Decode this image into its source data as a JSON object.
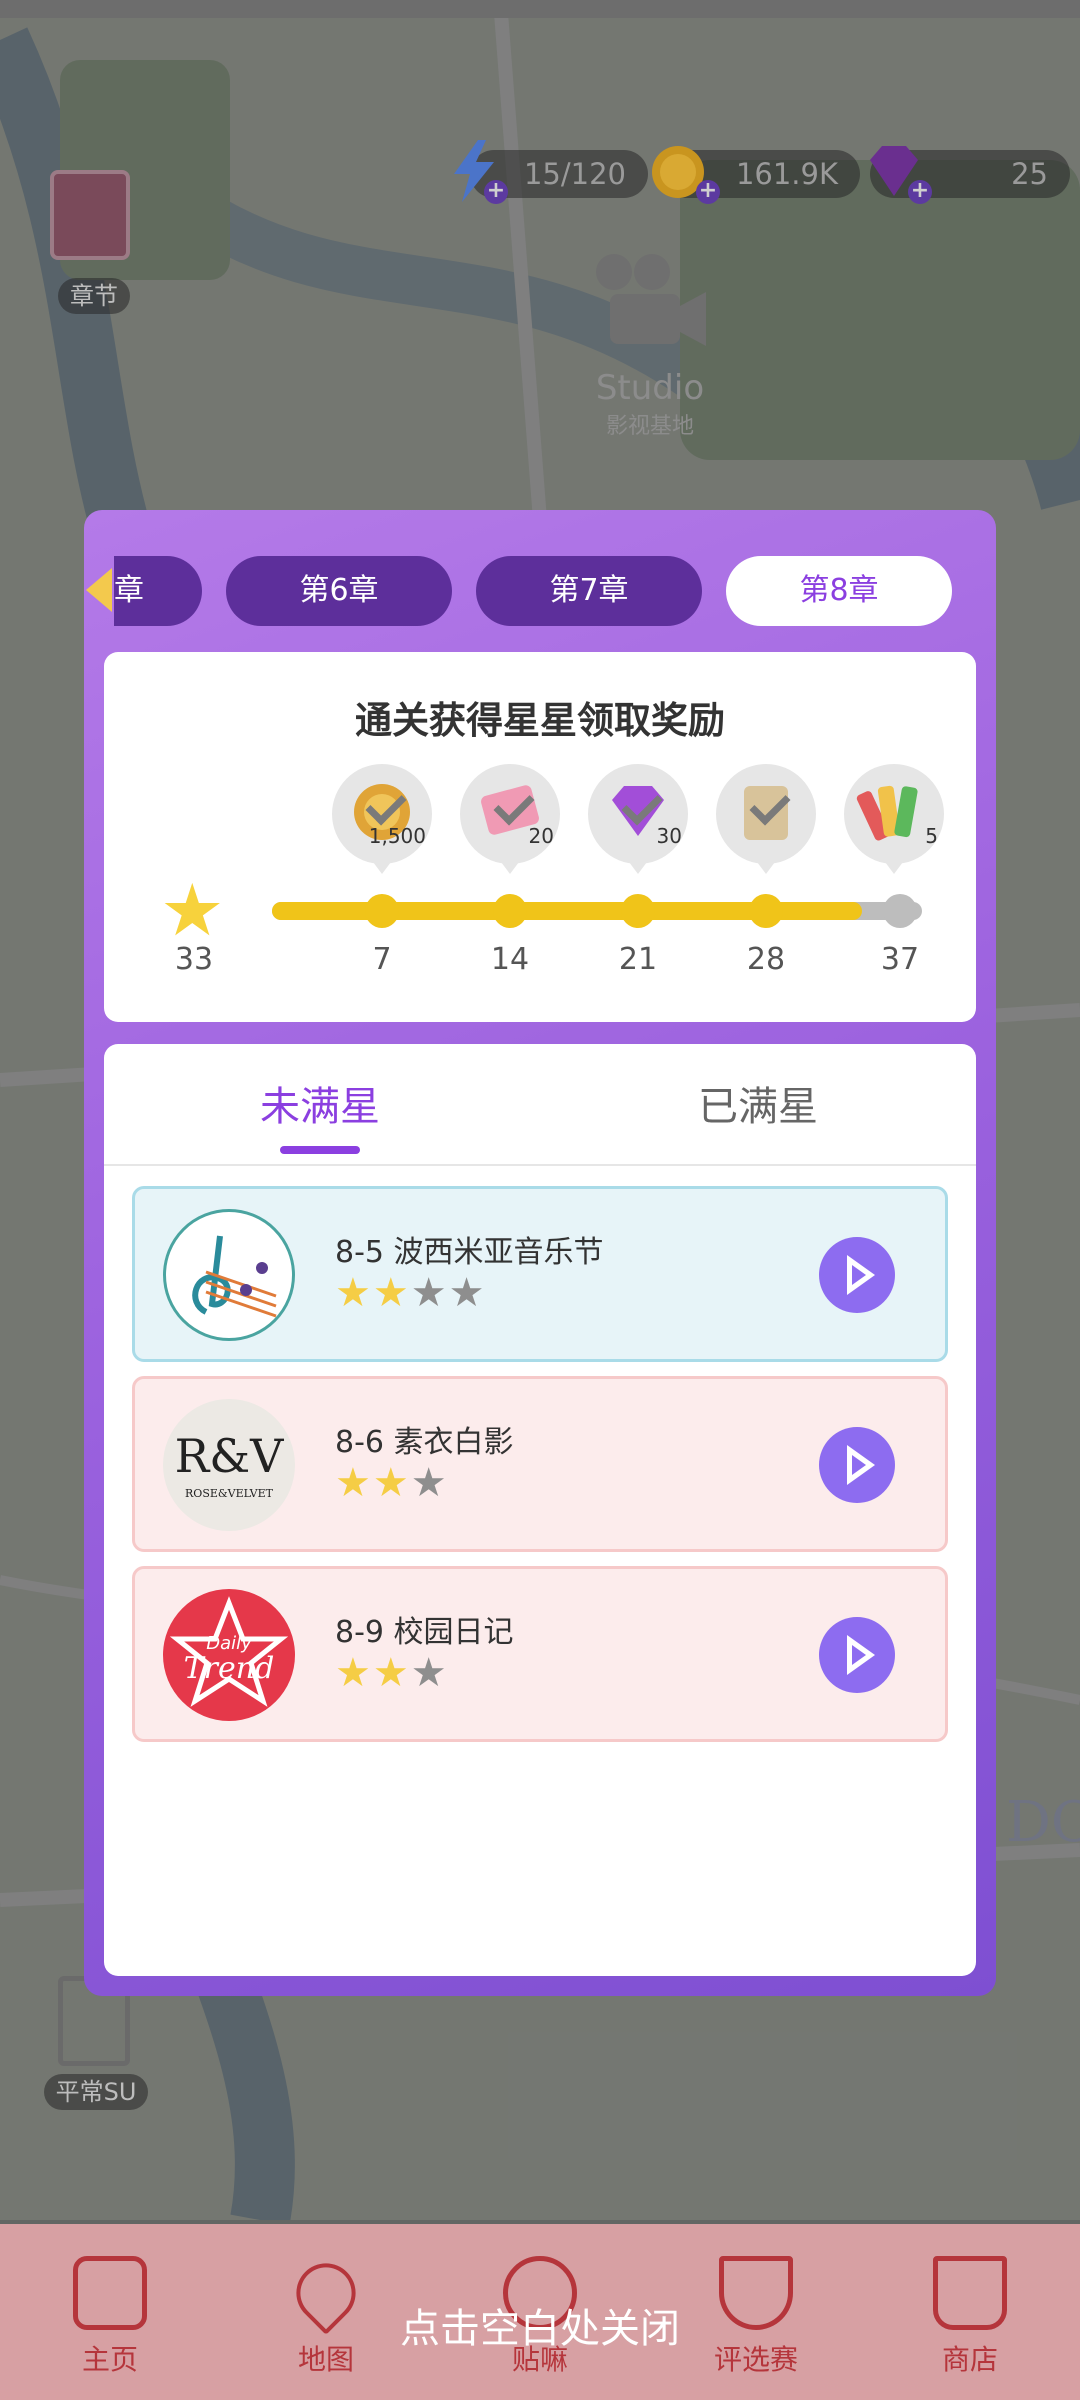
{
  "resources": [
    {
      "icon": "energy-bolt-icon",
      "value": "15/120"
    },
    {
      "icon": "gold-coin-icon",
      "value": "161.9K"
    },
    {
      "icon": "purple-gem-icon",
      "value": "25"
    }
  ],
  "map": {
    "chapter_button_label": "章节",
    "studio_label": "Studio",
    "studio_sub_label": "影视基地",
    "door_label": "平常SU",
    "edge_text": "DO"
  },
  "chapters": {
    "partial_label": "章",
    "tabs": [
      {
        "label": "第6章",
        "active": false
      },
      {
        "label": "第7章",
        "active": false
      },
      {
        "label": "第8章",
        "active": true
      }
    ]
  },
  "reward": {
    "title": "通关获得星星领取奖励",
    "current_stars": "33",
    "milestones": [
      {
        "stars": "7",
        "reward_icon": "gold-coin-reward-icon",
        "amount": "1,500",
        "claimed": true
      },
      {
        "stars": "14",
        "reward_icon": "ticket-reward-icon",
        "amount": "20",
        "claimed": true
      },
      {
        "stars": "21",
        "reward_icon": "purple-gem-reward-icon",
        "amount": "30",
        "claimed": true
      },
      {
        "stars": "28",
        "reward_icon": "card-reward-icon",
        "amount": "",
        "claimed": true
      },
      {
        "stars": "37",
        "reward_icon": "color-palette-reward-icon",
        "amount": "5",
        "claimed": false
      }
    ],
    "progress_fraction": 0.89
  },
  "list_tabs": {
    "active": "未满星",
    "inactive": "已满星"
  },
  "levels": [
    {
      "name": "8-5 波西米亚音乐节",
      "logo": "music-notes-logo",
      "stars_earned": 2,
      "stars_total": 4,
      "style": "blue"
    },
    {
      "name": "8-6 素衣白影",
      "logo": "rose-velvet-logo",
      "logo_text": "R&V",
      "logo_sub": "ROSE&VELVET",
      "stars_earned": 2,
      "stars_total": 3,
      "style": "pink"
    },
    {
      "name": "8-9 校园日记",
      "logo": "daily-trend-logo",
      "logo_text": "Daily",
      "logo_sub": "Trend",
      "stars_earned": 2,
      "stars_total": 3,
      "style": "pink"
    }
  ],
  "bottom_nav": [
    {
      "label": "主页",
      "icon": "home-icon"
    },
    {
      "label": "地图",
      "icon": "map-pin-icon"
    },
    {
      "label": "贴嘛",
      "icon": "camera-icon"
    },
    {
      "label": "评选赛",
      "icon": "trophy-icon"
    },
    {
      "label": "商店",
      "icon": "cart-icon"
    }
  ],
  "close_hint": "点击空白处关闭",
  "colors": {
    "accent_purple": "#8b3fe0",
    "tab_dark": "#5d2f9b",
    "progress_yellow": "#f0c419",
    "nav_red": "#b5353b"
  }
}
